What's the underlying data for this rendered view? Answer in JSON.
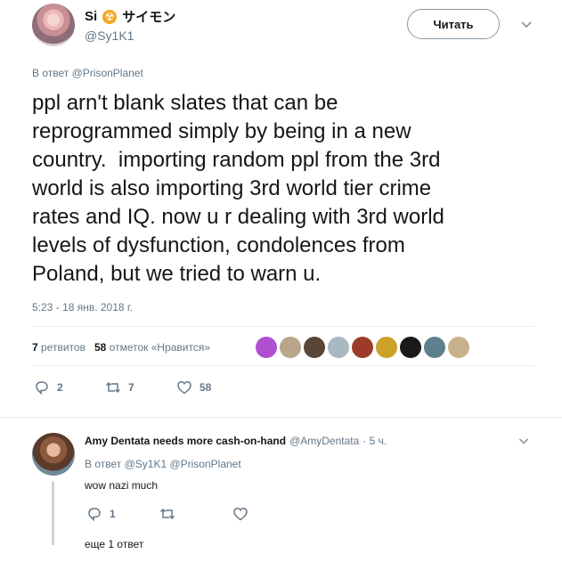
{
  "author": {
    "name_prefix": "Si",
    "name_suffix": "サイモン",
    "handle": "@Sy1K1"
  },
  "follow_button_label": "Читать",
  "tweet": {
    "reply_to": "В ответ @PrisonPlanet",
    "text": "ppl arn't blank slates that can be\nreprogrammed simply by being in a new\ncountry.  importing random ppl from the 3rd\nworld is also importing 3rd world tier crime\nrates and IQ. now u r dealing with 3rd world\nlevels of dysfunction, condolences from\nPoland, but we tried to warn u.",
    "timestamp": "5:23 - 18 янв. 2018 г."
  },
  "stats": {
    "retweets_count": "7",
    "retweets_label": "ретвитов",
    "likes_count": "58",
    "likes_label": "отметок «Нравится»"
  },
  "likers": [
    {
      "icon": "avatar-purple",
      "color": "#b04fd0"
    },
    {
      "icon": "avatar-figure",
      "color": "#b8a58a"
    },
    {
      "icon": "avatar-dark",
      "color": "#5b4636"
    },
    {
      "icon": "avatar-default",
      "color": "#aab8c2"
    },
    {
      "icon": "avatar-red",
      "color": "#9c3b2a"
    },
    {
      "icon": "avatar-card",
      "color": "#c9a227"
    },
    {
      "icon": "avatar-black",
      "color": "#1a1a1a"
    },
    {
      "icon": "avatar-cartoon",
      "color": "#5f7f8f"
    },
    {
      "icon": "avatar-deer",
      "color": "#c8b08a"
    }
  ],
  "actions": {
    "replies": "2",
    "retweets": "7",
    "likes": "58"
  },
  "reply": {
    "name": "Amy Dentata needs more cash-on-hand",
    "handle": "@AmyDentata",
    "time": "· 5 ч.",
    "reply_to": "В ответ @Sy1K1 @PrisonPlanet",
    "text": "wow nazi much",
    "replies": "1",
    "more_label": "еще 1 ответ"
  }
}
